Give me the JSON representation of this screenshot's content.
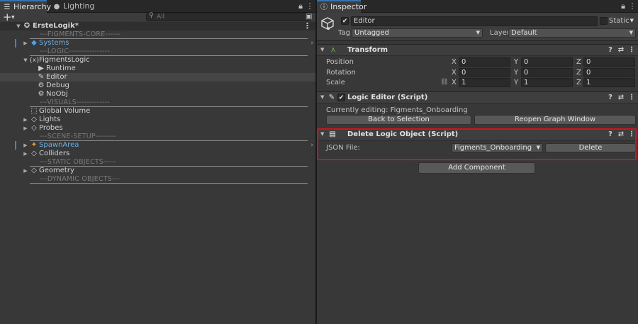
{
  "hierarchy_tab": {
    "label": "Hierarchy",
    "icon": "list-icon"
  },
  "lighting_tab": {
    "label": "Lighting",
    "icon": "lightbulb-icon"
  },
  "inspector_tab": {
    "label": "Inspector",
    "icon": "info-icon"
  },
  "search": {
    "placeholder": "All"
  },
  "tree": {
    "scene": "ErsteLogik*",
    "sep_core": "---FIGMENTS-CORE------",
    "systems": "Systems",
    "sep_logic": "---LOGIC----------------",
    "figments_logic": "FigmentsLogic",
    "runtime": "Runtime",
    "editor": "Editor",
    "debug": "Debug",
    "noobj": "NoObj",
    "sep_visuals": "---VISUALS-------------",
    "global_volume": "Global Volume",
    "lights": "Lights",
    "probes": "Probes",
    "sep_scene_setup": "---SCENE-SETUP--------",
    "spawn_area": "SpawnArea",
    "colliders": "Colliders",
    "sep_static": "---STATIC OBJECTS-----",
    "geometry": "Geometry",
    "sep_dynamic": "---DYNAMIC OBJECTS---"
  },
  "inspector": {
    "object_name": "Editor",
    "static_label": "Static",
    "tag_label": "Tag",
    "tag_value": "Untagged",
    "layer_label": "Layer",
    "layer_value": "Default",
    "transform": {
      "title": "Transform",
      "position_label": "Position",
      "rotation_label": "Rotation",
      "scale_label": "Scale",
      "x": "X",
      "y": "Y",
      "z": "Z",
      "position": [
        "0",
        "0",
        "0"
      ],
      "rotation": [
        "0",
        "0",
        "0"
      ],
      "scale": [
        "1",
        "1",
        "1"
      ]
    },
    "logic_editor": {
      "title": "Logic Editor (Script)",
      "status": "Currently editing: Figments_Onboarding",
      "back_button": "Back to Selection",
      "reopen_button": "Reopen Graph Window"
    },
    "delete_logic": {
      "title": "Delete Logic Object (Script)",
      "json_label": "JSON File:",
      "json_value": "Figments_Onboarding",
      "delete_button": "Delete"
    },
    "add_component": "Add Component"
  },
  "colors": {
    "selection_highlight": "#d0121b",
    "link_blue": "#6aaee6",
    "panel_bg": "#383838"
  }
}
